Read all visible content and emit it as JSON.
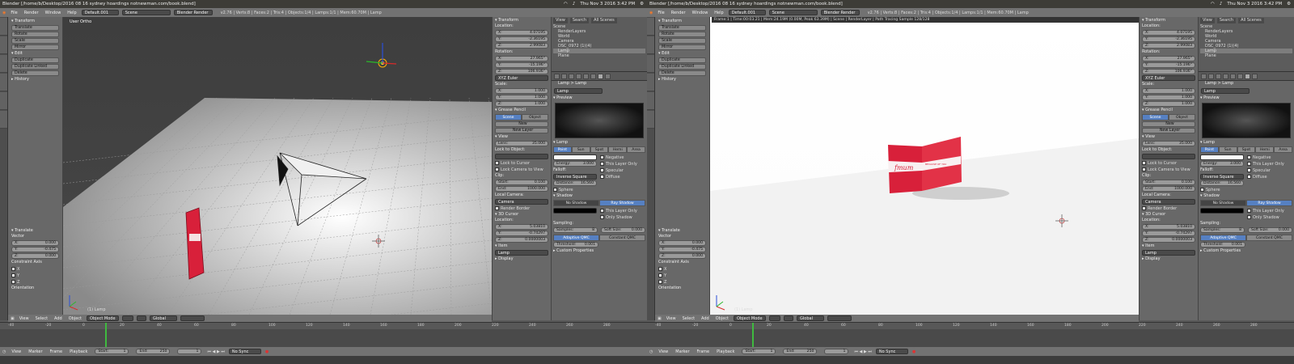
{
  "system": {
    "title": "Blender [/home/b/Desktop/2016 08 16 sydney hoardings notnewman.com/book.blend]",
    "clock": "Thu Nov 3 2016 3:42 PM"
  },
  "menu": {
    "items": [
      "File",
      "Render",
      "Window",
      "Help"
    ],
    "layout": "Default.001",
    "scene": "Scene",
    "engine": "Blender Render",
    "stats": "v2.76 | Verts:8 | Faces:2 | Tris:4 | Objects:1/4 | Lamps:1/1 | Mem:60.70M | Lamp"
  },
  "toolshelf": {
    "transform_header": "Transform",
    "transform_buttons": [
      "Translate",
      "Rotate",
      "Scale",
      "Mirror"
    ],
    "edit_header": "Edit",
    "edit_buttons": [
      "Duplicate",
      "Duplicate Linked",
      "Delete"
    ],
    "history_header": "History",
    "operator_header": "Translate",
    "vector_label": "Vector",
    "vector": [
      {
        "k": "X:",
        "v": "0.000"
      },
      {
        "k": "Y:",
        "v": "-0.475"
      },
      {
        "k": "Z:",
        "v": "0.000"
      }
    ],
    "constraint_label": "Constraint Axis",
    "constraint_axes": [
      "X",
      "Y",
      "Z"
    ],
    "orientation_label": "Orientation"
  },
  "viewport_left": {
    "label": "User Ortho",
    "object_label": "(1) Lamp"
  },
  "viewport_right": {
    "info": "Frame:1 | Time:00:03.21 | Mem:24.19M (0.00M, Peak 63.39M) | Scene | RenderLayer | Path Tracing Sample 128/128",
    "object_label": "(1) Lamp",
    "book_title": "fmum",
    "book_subtitle": "BECAUSE OF YOU"
  },
  "npanel": {
    "transform_header": "Transform",
    "location_label": "Location:",
    "location": [
      {
        "k": "X:",
        "v": "4.07195"
      },
      {
        "k": "Y:",
        "v": "-2.36195"
      },
      {
        "k": "Z:",
        "v": "2.99083"
      }
    ],
    "rotation_label": "Rotation:",
    "rotation": [
      {
        "k": "X:",
        "v": "27.965°"
      },
      {
        "k": "Y:",
        "v": "-15.196°"
      },
      {
        "k": "Z:",
        "v": "106.936°"
      }
    ],
    "rotation_mode": "XYZ Euler",
    "scale_label": "Scale:",
    "scale": [
      {
        "k": "X:",
        "v": "1.000"
      },
      {
        "k": "Y:",
        "v": "1.000"
      },
      {
        "k": "Z:",
        "v": "1.000"
      }
    ],
    "gp_header": "Grease Pencil",
    "gp_tabs": [
      "Scene",
      "Object"
    ],
    "gp_new": "New",
    "gp_new_layer": "New Layer",
    "view_header": "View",
    "lens": {
      "k": "Lens:",
      "v": "35.000"
    },
    "lock_label": "Lock to Object:",
    "lock_checks": [
      "Lock to Cursor",
      "Lock Camera to View"
    ],
    "clip_label": "Clip:",
    "clip": [
      {
        "k": "Start:",
        "v": "0.100"
      },
      {
        "k": "End:",
        "v": "1000.000"
      }
    ],
    "local_camera": "Local Camera:",
    "camera": "Camera",
    "render_border": "Render Border",
    "cursor_header": "3D Cursor",
    "cursor_location_label": "Location:",
    "cursor": [
      {
        "k": "X:",
        "v": "5.03810"
      },
      {
        "k": "Y:",
        "v": "-0.74297"
      },
      {
        "k": "Z:",
        "v": "0.0000003"
      }
    ],
    "item_header": "Item",
    "item_name": "Lamp",
    "display_header": "Display"
  },
  "outliner": {
    "header_tabs": [
      "View",
      "Search",
      "All Scenes"
    ],
    "tree": [
      "Scene",
      "RenderLayers",
      "World",
      "Camera",
      "DSC_0972 (1)(4)",
      "Lamp",
      "Plane"
    ]
  },
  "props": {
    "breadcrumb": "Lamp  >  Lamp",
    "lamp_name": "Lamp",
    "preview_header": "Preview",
    "lamp_header": "Lamp",
    "lamp_types": [
      "Point",
      "Sun",
      "Spot",
      "Hemi",
      "Area"
    ],
    "energy": {
      "k": "Energy:",
      "v": "3.000"
    },
    "falloff_label": "Falloff:",
    "falloff": "Inverse Square",
    "distance": {
      "k": "Distance:",
      "v": "16.560"
    },
    "sphere": "Sphere",
    "checks": [
      "Negative",
      "This Layer Only",
      "Specular",
      "Diffuse"
    ],
    "shadow_header": "Shadow",
    "shadow_types": [
      "No Shadow",
      "Ray Shadow"
    ],
    "shadow_checks": [
      "This Layer Only",
      "Only Shadow"
    ],
    "sampling_label": "Sampling:",
    "samples": {
      "k": "Samples:",
      "v": "8"
    },
    "soft_size": {
      "k": "Soft Size:",
      "v": "0.000"
    },
    "qmc": [
      "Adaptive QMC",
      "Constant QMC"
    ],
    "threshold": {
      "k": "Threshold:",
      "v": "0.001"
    },
    "custom_props": "Custom Properties"
  },
  "header3d": {
    "menus": [
      "View",
      "Select",
      "Add",
      "Object"
    ],
    "mode": "Object Mode",
    "orientation": "Global"
  },
  "timeline": {
    "ticks": [
      "-40",
      "-20",
      "0",
      "20",
      "40",
      "60",
      "80",
      "100",
      "120",
      "140",
      "160",
      "180",
      "200",
      "220",
      "240",
      "260",
      "280"
    ],
    "menus": [
      "View",
      "Marker",
      "Frame",
      "Playback"
    ],
    "start": {
      "k": "Start:",
      "v": "1"
    },
    "end": {
      "k": "End:",
      "v": "250"
    },
    "current": "1",
    "sync": "No Sync"
  },
  "colors": {
    "accent": "#5680c2",
    "playhead": "#3fba3f",
    "book": "#d8203a"
  }
}
